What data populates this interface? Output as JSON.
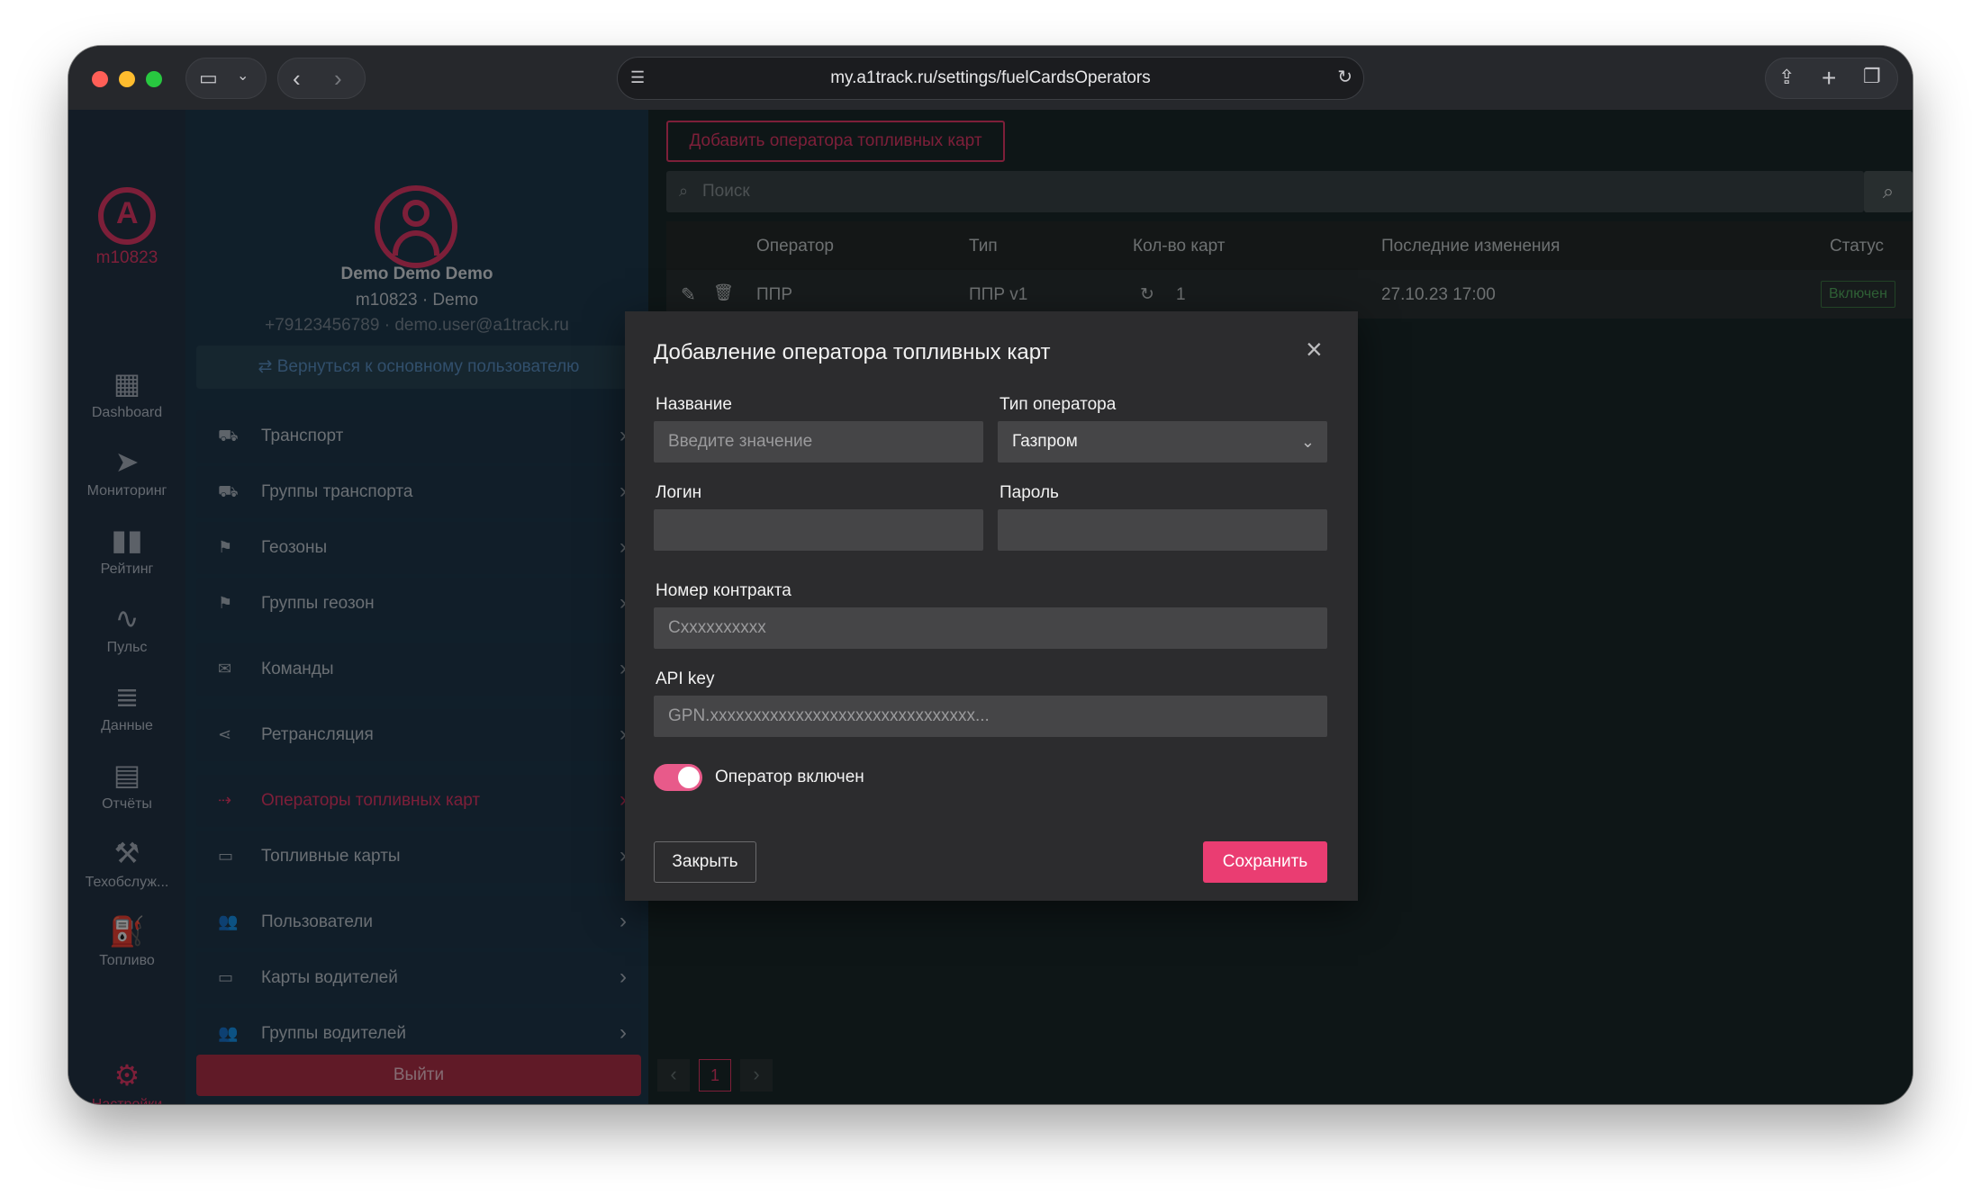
{
  "browser": {
    "url": "my.a1track.ru/settings/fuelCardsOperators"
  },
  "user": {
    "account_id": "m10823",
    "name": "Demo Demo Demo",
    "sub": "m10823 · Demo",
    "contact": "+79123456789 · demo.user@a1track.ru",
    "switch_back": "Вернуться к основному пользователю",
    "logout": "Выйти"
  },
  "nav": [
    {
      "label": "Dashboard",
      "icon": "dashboard-icon"
    },
    {
      "label": "Мониторинг",
      "icon": "navigation-arrow-icon"
    },
    {
      "label": "Рейтинг",
      "icon": "bar-chart-icon"
    },
    {
      "label": "Пульс",
      "icon": "pulse-icon"
    },
    {
      "label": "Данные",
      "icon": "database-icon"
    },
    {
      "label": "Отчёты",
      "icon": "report-icon"
    },
    {
      "label": "Техобслуж...",
      "icon": "maintenance-icon"
    },
    {
      "label": "Топливо",
      "icon": "fuel-icon"
    },
    {
      "label": "Настройки",
      "icon": "gear-icon"
    }
  ],
  "settings_menu": [
    {
      "label": "Транспорт",
      "icon": "truck-icon"
    },
    {
      "label": "Группы транспорта",
      "icon": "vehicle-group-icon"
    },
    {
      "label": "Геозоны",
      "icon": "geozone-icon"
    },
    {
      "label": "Группы геозон",
      "icon": "geozone-group-icon"
    },
    {
      "label": "Команды",
      "icon": "command-icon"
    },
    {
      "label": "Ретрансляция",
      "icon": "share-icon"
    },
    {
      "label": "Операторы топливных карт",
      "icon": "fuel-operator-icon"
    },
    {
      "label": "Топливные карты",
      "icon": "fuel-card-icon"
    },
    {
      "label": "Пользователи",
      "icon": "users-icon"
    },
    {
      "label": "Карты водителей",
      "icon": "driver-card-icon"
    },
    {
      "label": "Группы водителей",
      "icon": "driver-group-icon"
    }
  ],
  "main": {
    "add_button": "Добавить оператора топливных карт",
    "search_placeholder": "Поиск",
    "columns": [
      "Оператор",
      "Тип",
      "Кол-во карт",
      "Последние изменения",
      "Статус"
    ],
    "rows": [
      {
        "operator": "ППР",
        "type": "ППР v1",
        "cards": "1",
        "changed": "27.10.23 17:00",
        "status": "Включен"
      }
    ],
    "page": "1"
  },
  "modal": {
    "title": "Добавление оператора топливных карт",
    "name_label": "Название",
    "name_placeholder": "Введите значение",
    "type_label": "Тип оператора",
    "type_value": "Газпром",
    "login_label": "Логин",
    "password_label": "Пароль",
    "contract_label": "Номер контракта",
    "contract_placeholder": "Cxxxxxxxxxx",
    "api_label": "API key",
    "api_placeholder": "GPN.xxxxxxxxxxxxxxxxxxxxxxxxxxxxxxx...",
    "toggle_label": "Оператор включен",
    "close_button": "Закрыть",
    "save_button": "Сохранить"
  },
  "colors": {
    "accent": "#e73a6a",
    "status_green": "#4caf50"
  }
}
